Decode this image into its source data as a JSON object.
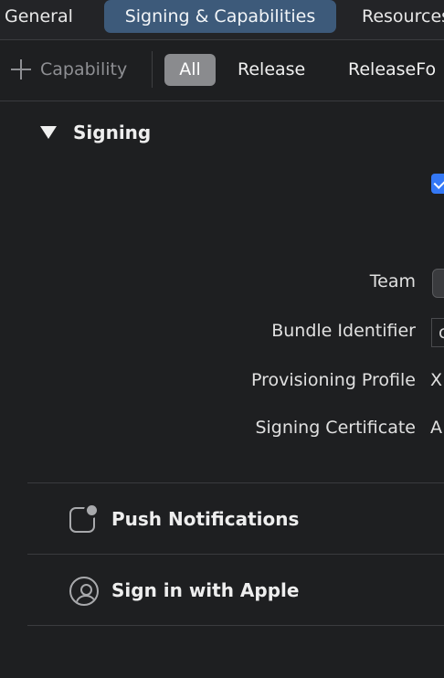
{
  "tabs": {
    "general": "General",
    "signing": "Signing & Capabilities",
    "resources": "Resources"
  },
  "filter": {
    "add_capability": "Capability",
    "segments": [
      "All",
      "Release",
      "ReleaseFo"
    ],
    "selected": "All"
  },
  "signing": {
    "title": "Signing",
    "auto_manage_checked": true,
    "team_label": "Team",
    "bundle_label": "Bundle Identifier",
    "bundle_value": "c",
    "provisioning_label": "Provisioning Profile",
    "provisioning_value": "X",
    "certificate_label": "Signing Certificate",
    "certificate_value": "A"
  },
  "capabilities": [
    {
      "title": "Push Notifications",
      "icon": "notification-icon"
    },
    {
      "title": "Sign in with Apple",
      "icon": "person-circle-icon"
    }
  ],
  "colors": {
    "background": "#1e1f21",
    "selected_tab": "#3d5a7a",
    "selected_segment": "#8a8b8e",
    "checkbox": "#3478f6"
  }
}
